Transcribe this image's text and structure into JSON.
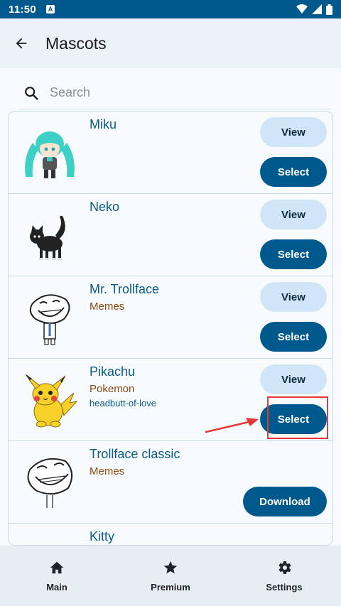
{
  "status_bar": {
    "time": "11:50",
    "notification_badge": "A"
  },
  "app_bar": {
    "title": "Mascots",
    "back_icon": "arrow-back-icon"
  },
  "search": {
    "placeholder": "Search",
    "value": ""
  },
  "mascots": [
    {
      "name": "Miku",
      "category": "",
      "tag": "",
      "view_label": "View",
      "action_label": "Select",
      "image": "miku-chibi"
    },
    {
      "name": "Neko",
      "category": "",
      "tag": "",
      "view_label": "View",
      "action_label": "Select",
      "image": "black-cat"
    },
    {
      "name": "Mr. Trollface",
      "category": "Memes",
      "tag": "",
      "view_label": "View",
      "action_label": "Select",
      "image": "trollface-suit"
    },
    {
      "name": "Pikachu",
      "category": "Pokemon",
      "tag": "headbutt-of-love",
      "view_label": "View",
      "action_label": "Select",
      "image": "pikachu"
    },
    {
      "name": "Trollface classic",
      "category": "Memes",
      "tag": "",
      "action_label": "Download",
      "image": "trollface"
    },
    {
      "name": "Kitty",
      "category": "",
      "tag": ""
    }
  ],
  "bottom_nav": [
    {
      "label": "Main",
      "icon": "home-icon"
    },
    {
      "label": "Premium",
      "icon": "star-icon"
    },
    {
      "label": "Settings",
      "icon": "gear-icon"
    }
  ],
  "colors": {
    "primary": "#00598c",
    "tonal": "#d0e5f7",
    "name_text": "#0b5b86",
    "category_text": "#8c4a0e",
    "annotation": "#e53935"
  }
}
